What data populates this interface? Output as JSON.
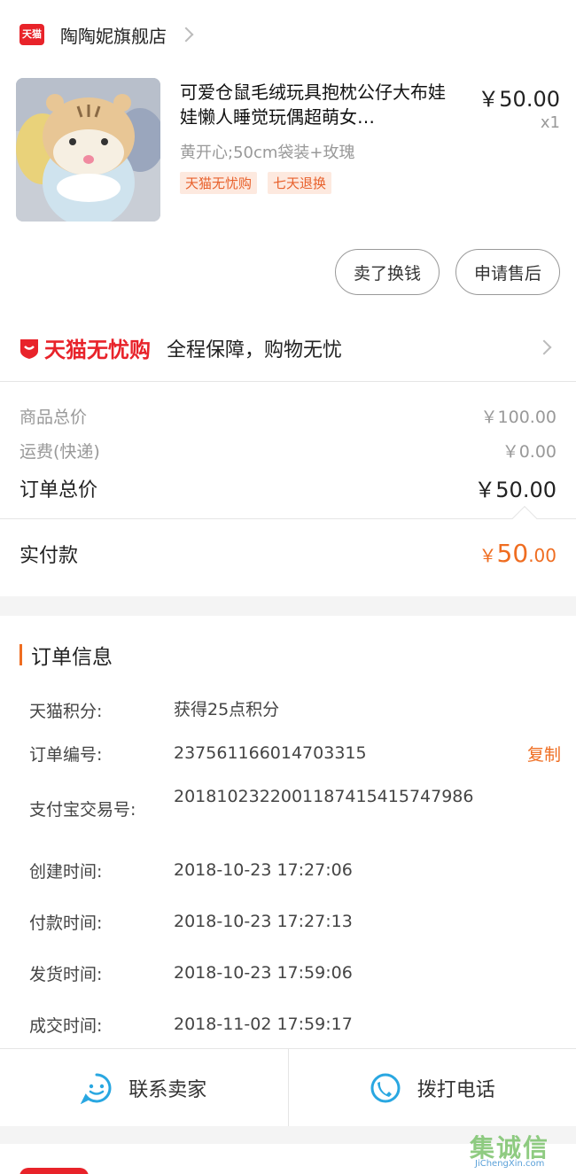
{
  "store": {
    "badge": "天猫",
    "name": "陶陶妮旗舰店"
  },
  "product": {
    "title": "可爱仓鼠毛绒玩具抱枕公仔大布娃娃懒人睡觉玩偶超萌女…",
    "price": "￥50.00",
    "qty": "x1",
    "spec": "黄开心;50cm袋装+玫瑰",
    "tags": [
      "天猫无忧购",
      "七天退换"
    ]
  },
  "actions": {
    "sell": "卖了换钱",
    "after_sale": "申请售后"
  },
  "guarantee": {
    "logo": "天猫无忧购",
    "text": "全程保障，购物无忧"
  },
  "summary": {
    "goods_total_label": "商品总价",
    "goods_total": "￥100.00",
    "shipping_label": "运费(快递)",
    "shipping": "￥0.00",
    "order_total_label": "订单总价",
    "order_total": "￥50.00",
    "paid_label": "实付款",
    "paid_currency": "￥",
    "paid_int": "50",
    "paid_dec": ".00"
  },
  "order_info": {
    "title": "订单信息",
    "copy": "复制",
    "rows": [
      {
        "label": "天猫积分:",
        "value": "获得25点积分"
      },
      {
        "label": "订单编号:",
        "value": "237561166014703315"
      },
      {
        "label": "支付宝交易号:",
        "value": "2018102322001187415415747986"
      },
      {
        "label": "创建时间:",
        "value": "2018-10-23 17:27:06"
      },
      {
        "label": "付款时间:",
        "value": "2018-10-23 17:27:13"
      },
      {
        "label": "发货时间:",
        "value": "2018-10-23 17:59:06"
      },
      {
        "label": "成交时间:",
        "value": "2018-11-02 17:59:17"
      }
    ]
  },
  "bottom": {
    "contact": "联系卖家",
    "call": "拨打电话"
  },
  "watermark": {
    "text": "集诚信",
    "sub": "JiChengXin.com"
  },
  "colors": {
    "tmall_red": "#e8232a",
    "accent_orange": "#ef6d21",
    "icon_blue": "#29a7e1"
  }
}
